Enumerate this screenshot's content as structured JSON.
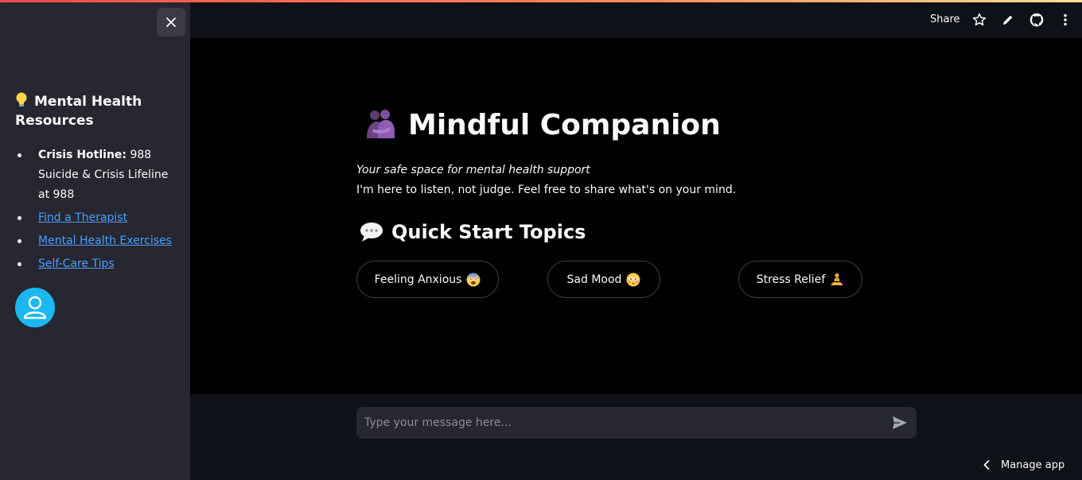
{
  "header": {
    "share_label": "Share",
    "icons": [
      "star-icon",
      "pencil-icon",
      "github-icon",
      "kebab-menu-icon"
    ]
  },
  "sidebar": {
    "heading_icon": "lightbulb-icon",
    "heading": "Mental Health Resources",
    "items": [
      {
        "bold": "Crisis Hotline:",
        "text": " 988 Suicide & Crisis Lifeline at 988"
      },
      {
        "link": "Find a Therapist"
      },
      {
        "link": "Mental Health Exercises"
      },
      {
        "link": "Self-Care Tips"
      }
    ]
  },
  "main": {
    "title": "Mindful Companion",
    "title_icon": "hugging-people-icon",
    "subtitle": "Your safe space for mental health support",
    "intro": "I'm here to listen, not judge. Feel free to share what's on your mind.",
    "section_title": "Quick Start Topics",
    "section_icon": "speech-bubble-icon",
    "topics": [
      {
        "label": "Feeling Anxious",
        "icon": "anxious-face-icon"
      },
      {
        "label": "Sad Mood",
        "icon": "flushed-face-icon"
      },
      {
        "label": "Stress Relief",
        "icon": "meditating-person-icon"
      }
    ]
  },
  "chat": {
    "placeholder": "Type your message here..."
  },
  "footer": {
    "manage_app_label": "Manage app"
  },
  "colors": {
    "accent_gradient_start": "#ff4b4b",
    "accent_gradient_end": "#ffe08a",
    "link": "#4b9eff",
    "avatar": "#1bb8f0",
    "sidebar_bg": "#262730",
    "main_bg": "#000000"
  }
}
